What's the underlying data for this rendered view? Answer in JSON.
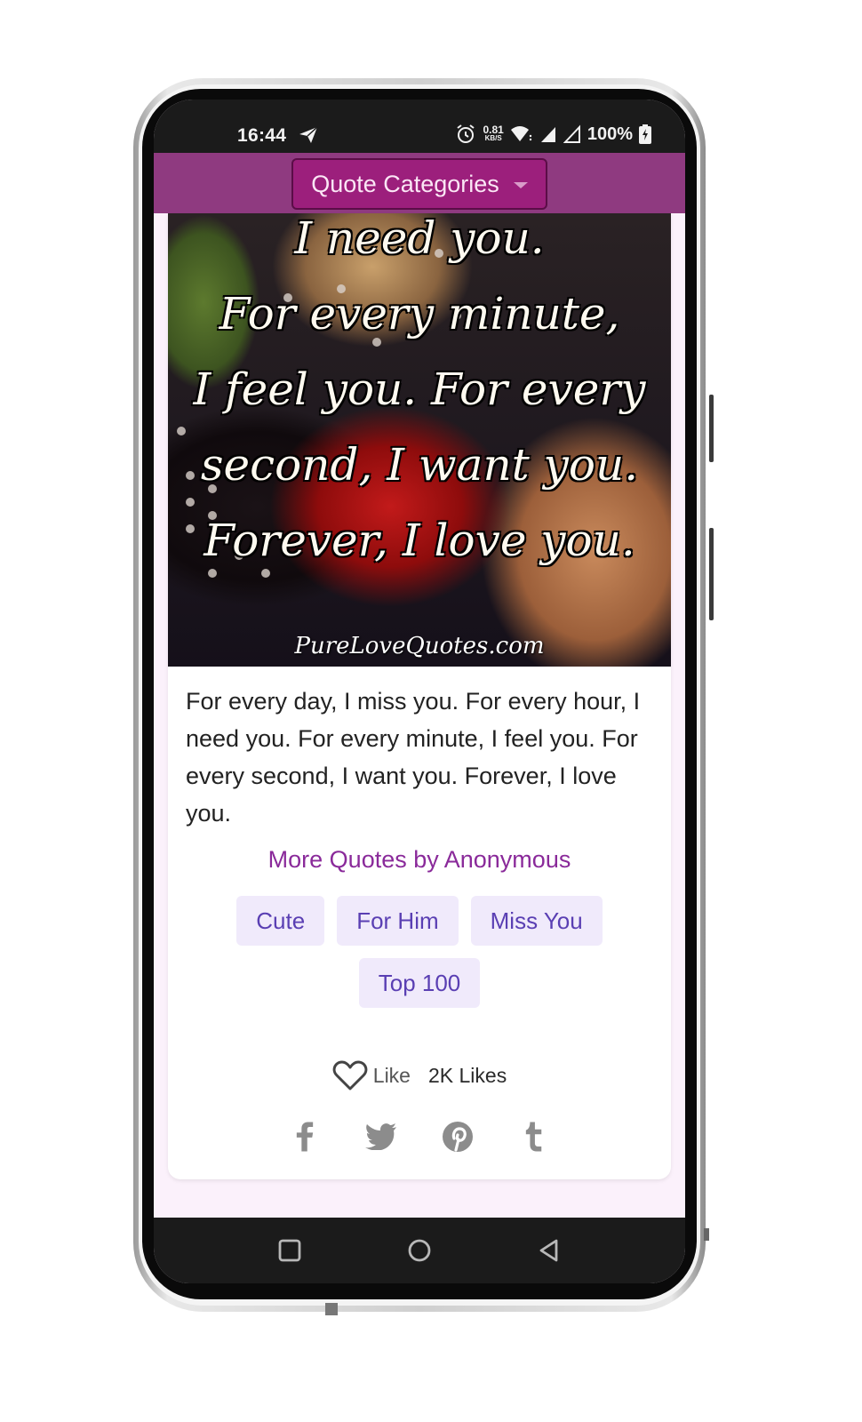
{
  "status_bar": {
    "time": "16:44",
    "net_speed_value": "0.81",
    "net_speed_unit": "KB/S",
    "battery_percent": "100%",
    "icons": [
      "telegram-send-icon",
      "alarm-icon",
      "wifi-icon",
      "signal-icon",
      "signal-icon",
      "battery-charging-icon"
    ]
  },
  "app_bar": {
    "dropdown_label": "Quote Categories"
  },
  "quote_image": {
    "lines": [
      "I need you.",
      "For every minute,",
      "I feel you. For every",
      "second, I want you.",
      "Forever, I love you."
    ],
    "watermark": "PureLoveQuotes.com"
  },
  "quote": {
    "text": "For every day, I miss you. For every hour, I need you. For every minute, I feel you. For every second, I want you. Forever, I love you.",
    "author_link": "More Quotes by Anonymous"
  },
  "tags": [
    "Cute",
    "For Him",
    "Miss You",
    "Top 100"
  ],
  "likes": {
    "like_label": "Like",
    "count_label": "2K Likes"
  },
  "share": [
    "facebook-icon",
    "twitter-icon",
    "pinterest-icon",
    "tumblr-icon"
  ],
  "colors": {
    "app_bar": "#8f3a80",
    "dropdown": "#9c1f7c",
    "author_link": "#8a2a9a",
    "tag_bg": "#f0eafb",
    "tag_text": "#5a3fb3",
    "page_bg": "#fbf1fb"
  },
  "nav_bar": [
    "recents-icon",
    "home-icon",
    "back-icon"
  ]
}
